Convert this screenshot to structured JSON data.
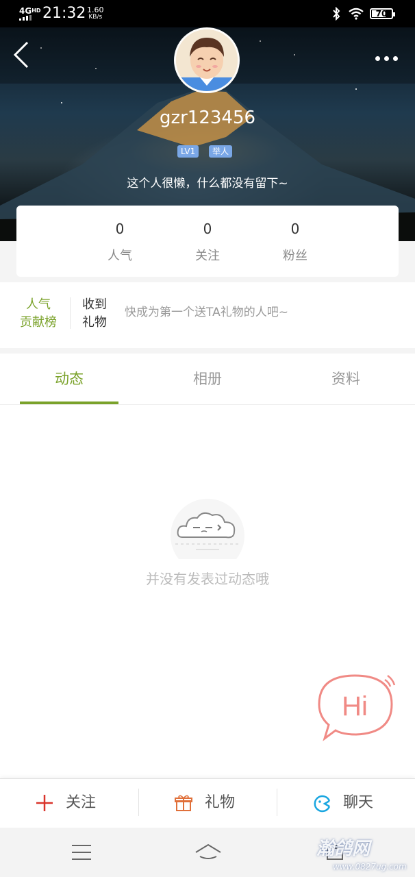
{
  "status_bar": {
    "network": "4G",
    "network_sup": "HD",
    "time": "21:32",
    "speed_value": "1.60",
    "speed_unit": "KB/s",
    "battery": "70",
    "battery_level": 0.7,
    "icons": [
      "signal-icon",
      "bluetooth-icon",
      "wifi-icon",
      "battery-icon"
    ]
  },
  "header": {
    "username": "gzr123456",
    "level_badge": "LV1",
    "report_badge": "举人",
    "bio": "这个人很懒，什么都没有留下~"
  },
  "stats": [
    {
      "value": "0",
      "label": "人气"
    },
    {
      "value": "0",
      "label": "关注"
    },
    {
      "value": "0",
      "label": "粉丝"
    }
  ],
  "gifts": {
    "rank_line1": "人气",
    "rank_line2": "贡献榜",
    "received_line1": "收到",
    "received_line2": "礼物",
    "tip": "快成为第一个送TA礼物的人吧~"
  },
  "tabs": [
    {
      "label": "动态",
      "active": true
    },
    {
      "label": "相册",
      "active": false
    },
    {
      "label": "资料",
      "active": false
    }
  ],
  "empty_state": {
    "text": "并没有发表过动态哦"
  },
  "hi_bubble": "Hi",
  "action_bar": {
    "follow": "关注",
    "gift": "礼物",
    "chat": "聊天"
  },
  "colors": {
    "accent": "#7aa22a",
    "follow_plus": "#d9342b",
    "gift_icon": "#e0703a",
    "chat_icon": "#1aa6e0",
    "hi": "#f08a85"
  },
  "watermark": {
    "line1": "瀚鸽网",
    "line2": "www.0827ug.com"
  }
}
